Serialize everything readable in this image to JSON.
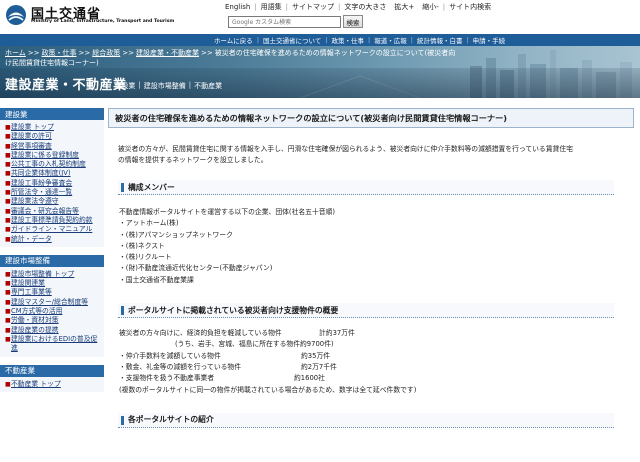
{
  "header": {
    "logo_title": "国土交通省",
    "logo_sub": "Ministry of Land, Infrastructure, Transport and Tourism",
    "top_links": [
      "English",
      "用語集",
      "サイトマップ"
    ],
    "font_size_label": "文字の大きさ",
    "font_size_up": "拡大+",
    "font_size_down": "縮小-",
    "site_search": "サイト内検索",
    "search_placeholder": "Google カスタム検索",
    "search_button": "検索"
  },
  "nav": {
    "items": [
      "ホームに戻る",
      "国土交通省について",
      "政策・仕事",
      "報道・広報",
      "統計情報・白書",
      "申請・手続"
    ]
  },
  "banner": {
    "breadcrumb": [
      "ホーム",
      "政策・仕事",
      "総合政策",
      "建設産業・不動産業"
    ],
    "breadcrumb_current_1": "被災者の住宅確保を進めるための情報ネットワークの設立について(被災者向",
    "breadcrumb_current_2": "け民間賃貸住宅情報コーナー)",
    "page_title": "建設産業・不動産業",
    "subnav": [
      "建設業",
      "建設市場整備",
      "不動産業"
    ]
  },
  "sidebar": {
    "sections": [
      {
        "title": "建設業",
        "items": [
          "建設業 トップ",
          "建設業の許可",
          "経営事項審査",
          "建設業に係る登録制度",
          "公共工事の入札契約制度",
          "共同企業体制度(JV)",
          "建設工事紛争審査会",
          "所管法令・通達一覧",
          "建設業法令遵守",
          "審議会・研究会報告等",
          "建設工事標準請負契約約款",
          "ガイドライン・マニュアル",
          "統計・データ"
        ]
      },
      {
        "title": "建設市場整備",
        "items": [
          "建設市場整備 トップ",
          "建設関連業",
          "専門工事業等",
          "建設マスター/総合制度等",
          "CM方式等の活用",
          "労働・資材対策",
          "建設産業の提携",
          "建設業におけるEDIの普及促進"
        ]
      },
      {
        "title": "不動産業",
        "items": [
          "不動産業 トップ"
        ]
      }
    ]
  },
  "main": {
    "title": "被災者の住宅確保を進めるための情報ネットワークの設立について(被災者向け民間賃貸住宅情報コーナー)",
    "intro_1": "被災者の方々が、民間賃貸住宅に関する情報を入手し、円滑な住宅確保が図られるよう、被災者向けに仲介手数料等の減額措置を行っている賃貸住宅",
    "intro_2": "の情報を提供するネットワークを設立しました。",
    "members_title": "構成メンバー",
    "members_lead": "不動産情報ポータルサイトを運営する以下の企業、団体(社名五十音順)",
    "members": [
      "・アットホーム(株)",
      "・(株)アパマンショップネットワーク",
      "・(株)ネクスト",
      "・(株)リクルート",
      "・(財)不動産流通近代化センター(不動産ジャパン)",
      "・国土交通省不動産業課"
    ],
    "overview_title": "ポータルサイトに掲載されている被災者向け支援物件の概要",
    "ov1_label": "被災者の方々向けに、経済的負担を軽減している物件",
    "ov1_value": "計約37万件",
    "ov1_sub": "(うち、岩手、宮城、福島に所在する物件約9700件)",
    "ov2_label": "・仲介手数料を減額している物件",
    "ov2_value": "約35万件",
    "ov3_label": "・敷金、礼金等の減額を行っている物件",
    "ov3_value": "約2万7千件",
    "ov4_label": "・支援物件を扱う不動産事業者",
    "ov4_value": "約1600社",
    "ov_note": "(複数のポータルサイトに同一の物件が掲載されている場合があるため、数字は全て延べ件数です)",
    "portals_title": "各ポータルサイトの紹介"
  },
  "colors": {
    "nav_blue": "#1f5d98",
    "sidebar_head": "#2a6aa6",
    "link": "#1a3d7a",
    "bullet": "#b10000"
  }
}
